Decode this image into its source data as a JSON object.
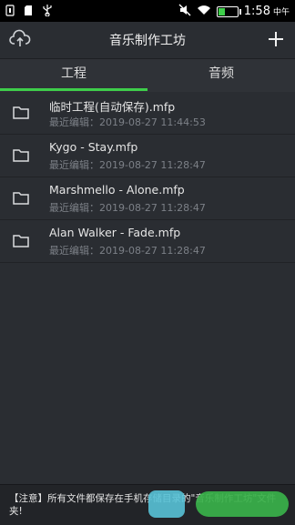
{
  "status_bar": {
    "time": "1:58",
    "ampm": "中午",
    "battery_level": 0.35,
    "icons": [
      "notification-icon",
      "sd-card-icon",
      "usb-icon",
      "mute-icon",
      "wifi-icon",
      "battery-icon"
    ]
  },
  "header": {
    "title": "音乐制作工坊",
    "left_icon": "cloud-upload-icon",
    "right_icon": "plus-icon"
  },
  "tabs": [
    {
      "label": "工程",
      "active": true
    },
    {
      "label": "音频",
      "active": false
    }
  ],
  "files": [
    {
      "name": "临时工程(自动保存).mfp",
      "date": "最近编辑：2019-08-27 11:44:53"
    },
    {
      "name": "Kygo - Stay.mfp",
      "date": "最近编辑：2019-08-27 11:28:47"
    },
    {
      "name": "Marshmello - Alone.mfp",
      "date": "最近编辑：2019-08-27 11:28:47"
    },
    {
      "name": "Alan Walker - Fade.mfp",
      "date": "最近编辑：2019-08-27 11:28:47"
    }
  ],
  "notice": {
    "text": "【注意】所有文件都保存在手机存储目录的\"音乐制作工坊\"文件夹!"
  },
  "colors": {
    "accent": "#3ecf4a",
    "background": "#2a2d32"
  }
}
